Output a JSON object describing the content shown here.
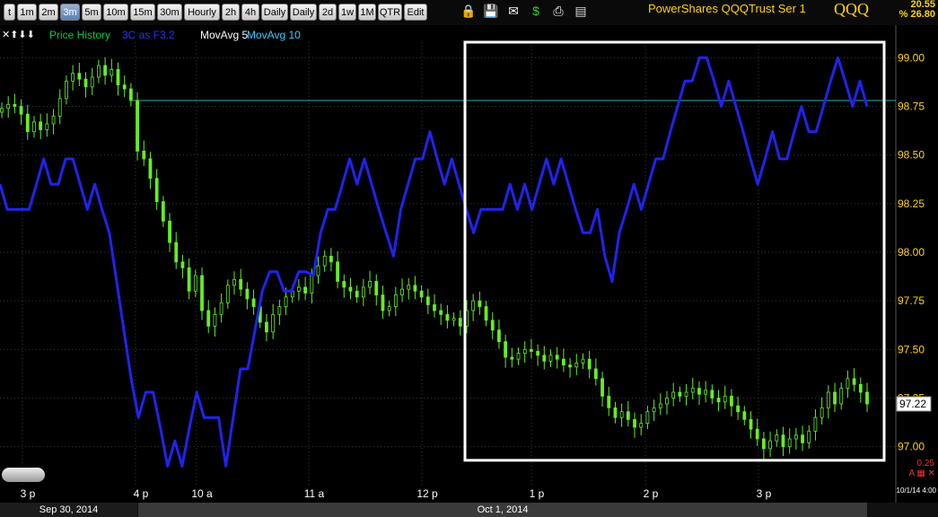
{
  "toolbar": {
    "buttons": [
      "t",
      "1m",
      "2m",
      "3m",
      "5m",
      "10m",
      "15m",
      "30m",
      "Hourly",
      "2h",
      "4h",
      "Daily",
      "Daily",
      "2d",
      "1w",
      "1M",
      "QTR",
      "Edit"
    ],
    "active_index": 3,
    "icons": [
      "lock-icon",
      "save-icon",
      "email-icon",
      "dollar-icon",
      "print-icon",
      "settings-panel-icon"
    ]
  },
  "header": {
    "title": "PowerShares QQQTrust Ser 1",
    "symbol": "QQQ",
    "last": "20.55",
    "change": "% 26.80"
  },
  "legend": {
    "controls": "✕⬆⬇⬇",
    "items": [
      {
        "label": "Price History",
        "color": "#00cc44"
      },
      {
        "label": "3C as F3.2",
        "color": "#2233ff"
      },
      {
        "label": "MovAvg 5",
        "color": "#ffffff"
      },
      {
        "label": "MovAvg 10",
        "color": "#33ccff"
      }
    ]
  },
  "colors": {
    "price": "#66ee22",
    "indicator": "#2222ee",
    "ref_line": "#3aa8b0",
    "grid": "#3a3a3a",
    "box": "#ffffff"
  },
  "chart_data": {
    "type": "candlestick",
    "y_ticks": [
      "99.00",
      "98.75",
      "98.50",
      "98.25",
      "98.00",
      "97.75",
      "97.50",
      "97.25",
      "97.00"
    ],
    "ylim": [
      96.92,
      99.08
    ],
    "x_ticks": [
      "3 p",
      "4 p",
      "10 a",
      "11 a",
      "12 p",
      "1 p",
      "2 p",
      "3 p"
    ],
    "last_price_label": "97.22",
    "reference_level": 98.78,
    "price_close": [
      98.74,
      98.76,
      98.75,
      98.71,
      98.62,
      98.67,
      98.63,
      98.66,
      98.7,
      98.79,
      98.88,
      98.92,
      98.89,
      98.85,
      98.9,
      98.96,
      98.91,
      98.94,
      98.86,
      98.84,
      98.78,
      98.52,
      98.48,
      98.38,
      98.26,
      98.16,
      98.05,
      97.95,
      97.92,
      97.8,
      97.88,
      97.7,
      97.62,
      97.68,
      97.74,
      97.83,
      97.86,
      97.81,
      97.76,
      97.72,
      97.64,
      97.59,
      97.68,
      97.72,
      97.77,
      97.8,
      97.82,
      97.79,
      97.88,
      97.93,
      97.98,
      97.95,
      97.85,
      97.82,
      97.8,
      97.77,
      97.82,
      97.85,
      97.78,
      97.7,
      97.72,
      97.78,
      97.81,
      97.83,
      97.8,
      97.77,
      97.73,
      97.7,
      97.68,
      97.65,
      97.66,
      97.62,
      97.7,
      97.75,
      97.72,
      97.65,
      97.6,
      97.54,
      97.46,
      97.45,
      97.48,
      97.5,
      97.49,
      97.47,
      97.44,
      97.47,
      97.45,
      97.42,
      97.41,
      97.43,
      97.45,
      97.4,
      97.35,
      97.26,
      97.2,
      97.15,
      97.18,
      97.14,
      97.1,
      97.12,
      97.18,
      97.2,
      97.22,
      97.25,
      97.28,
      97.26,
      97.28,
      97.3,
      97.27,
      97.29,
      97.25,
      97.23,
      97.26,
      97.21,
      97.18,
      97.14,
      97.09,
      97.04,
      96.99,
      97.03,
      97.06,
      97.0,
      97.04,
      97.06,
      97.02,
      97.08,
      97.15,
      97.2,
      97.28,
      97.22,
      97.3,
      97.35,
      97.32,
      97.28,
      97.22
    ],
    "indicator_units": "3C (unscaled, plotted on price axis)",
    "indicator": [
      98.35,
      98.22,
      98.22,
      98.22,
      98.22,
      98.35,
      98.48,
      98.35,
      98.35,
      98.48,
      98.48,
      98.35,
      98.22,
      98.35,
      98.22,
      98.1,
      97.85,
      97.6,
      97.35,
      97.15,
      97.28,
      97.28,
      97.1,
      96.9,
      97.03,
      96.9,
      97.1,
      97.28,
      97.15,
      97.15,
      97.15,
      96.9,
      97.15,
      97.4,
      97.4,
      97.6,
      97.8,
      97.9,
      97.9,
      97.8,
      97.8,
      97.9,
      97.9,
      97.88,
      98.1,
      98.22,
      98.22,
      98.35,
      98.48,
      98.35,
      98.48,
      98.35,
      98.22,
      98.1,
      97.98,
      98.22,
      98.35,
      98.48,
      98.48,
      98.62,
      98.48,
      98.35,
      98.48,
      98.35,
      98.22,
      98.1,
      98.22,
      98.22,
      98.22,
      98.22,
      98.35,
      98.22,
      98.35,
      98.22,
      98.35,
      98.48,
      98.35,
      98.48,
      98.35,
      98.22,
      98.1,
      98.1,
      98.22,
      97.98,
      97.85,
      98.1,
      98.22,
      98.35,
      98.22,
      98.35,
      98.48,
      98.48,
      98.62,
      98.75,
      98.88,
      98.88,
      99.0,
      99.0,
      98.88,
      98.75,
      98.88,
      98.75,
      98.62,
      98.48,
      98.35,
      98.48,
      98.62,
      98.48,
      98.48,
      98.62,
      98.75,
      98.62,
      98.62,
      98.75,
      98.88,
      99.0,
      98.88,
      98.75,
      98.88,
      98.75
    ],
    "highlight_box": {
      "start": "12:40",
      "end": "16:00",
      "y_range": [
        96.93,
        99.08
      ]
    }
  },
  "dates": {
    "left": "Sep 30, 2014",
    "right": "Oct 1, 2014",
    "timestamp": "10/1/14 4:00"
  },
  "scale": {
    "value": "0.25",
    "tools": "A ▦ ✕"
  }
}
